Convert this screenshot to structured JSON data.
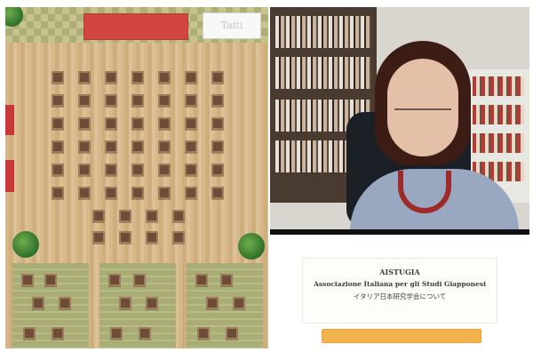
{
  "board": {
    "score_label": "Taiti"
  },
  "info": {
    "line1": "AISTUGIA",
    "line2": "Associazione Italiana per gli Studi Giapponesi",
    "line3": "イタリア日本研究学会について"
  },
  "colors": {
    "banner_red": "#d2463f",
    "button_orange": "#f2b34d",
    "board_wood": "#d7b88a"
  }
}
